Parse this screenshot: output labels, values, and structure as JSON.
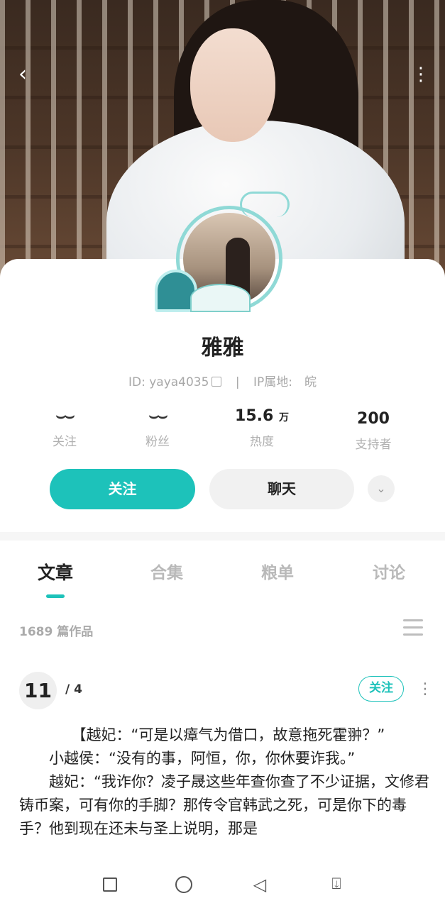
{
  "header": {
    "back_icon": "chevron-left-icon",
    "more_icon": "more-vertical-icon"
  },
  "profile": {
    "name": "雅雅",
    "id_text": "ID: yaya4035",
    "ip_text": "IP属地:　皖",
    "separator": "|"
  },
  "stats": [
    {
      "value": "",
      "icon": "closed-eye-icon",
      "label": "关注"
    },
    {
      "value": "",
      "icon": "closed-eye-icon",
      "label": "粉丝"
    },
    {
      "value": "15.6",
      "unit": "万",
      "label": "热度"
    },
    {
      "value": "200",
      "unit": "",
      "label": "支持者"
    }
  ],
  "actions": {
    "follow_label": "关注",
    "chat_label": "聊天",
    "more_icon": "chevron-down-icon"
  },
  "tabs": [
    {
      "label": "文章",
      "active": true
    },
    {
      "label": "合集",
      "active": false
    },
    {
      "label": "粮单",
      "active": false
    },
    {
      "label": "讨论",
      "active": false
    }
  ],
  "works_count": "1689 篇作品",
  "post": {
    "index": "11",
    "pages": "/ 4",
    "follow_label": "关注",
    "lines": [
      "　　　　【越妃：“可是以瘴气为借口，故意拖死霍翀？”",
      "　　小越侯：“没有的事，阿恒，你，你休要诈我。”",
      "　　越妃：“我诈你？凌子晟这些年查你查了不少证据，文修君铸币案，可有你的手脚？那传令官韩武之死，可是你下的毒手？他到现在还未与圣上说明，那是"
    ]
  },
  "colors": {
    "accent": "#1dc2ba"
  }
}
